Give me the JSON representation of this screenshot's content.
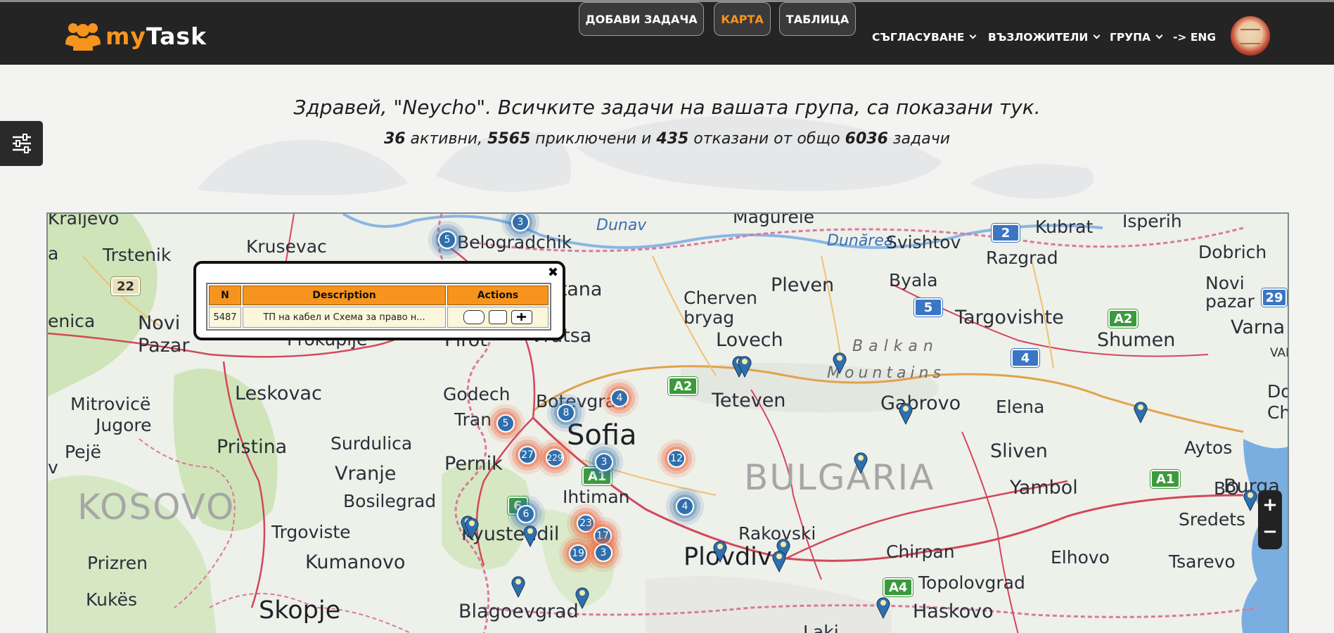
{
  "app": {
    "logo_my": "my",
    "logo_task": "Task"
  },
  "nav": {
    "add_task": "ДОБАВИ ЗАДАЧА",
    "map": "КАРТА",
    "table": "ТАБЛИЦА",
    "approval": "СЪГЛАСУВАНЕ",
    "assigners": "ВЪЗЛОЖИТЕЛИ",
    "group": "ГРУПА",
    "lang": "-> ENG",
    "active_tab": "map"
  },
  "greeting": {
    "title": "Здравей, \"Neycho\". Всичките задачи на вашата група, са показани тук.",
    "active_count": "36",
    "active_label": " активни, ",
    "finished_count": "5565",
    "finished_label": " приключени и ",
    "rejected_count": "435",
    "rejected_label": " отказани от общо ",
    "total_count": "6036",
    "total_label": " задачи"
  },
  "popup": {
    "columns": [
      "N",
      "Description",
      "Actions"
    ],
    "row": {
      "n": "5487",
      "description": "ТП на кабел и Схема за право н..."
    },
    "actions": [
      "details-icon",
      "edit-doc-icon",
      "add-icon"
    ]
  },
  "map": {
    "places": {
      "kraljevo": "Kraljevo",
      "trstenik": "Trstenik",
      "krusevac": "Krusevac",
      "belogradchik": "Belogradchik",
      "dunav": "Dunav",
      "magurele": "Magurele",
      "dunarea": "Dunărea",
      "svishtov": "Svishtov",
      "kubrat": "Kubrat",
      "isperih": "Isperih",
      "dobrich": "Dobrich",
      "razgrad": "Razgrad",
      "novi_pazar_bg": "Novi\npazar",
      "enica": "enica",
      "a_left": "a",
      "novi_pazar": "Novi\nPazar",
      "prokuplje": "Prokuplje",
      "pirot": "Pirot",
      "vratsa": "Vratsa",
      "montana": "ontana",
      "cherven_bryag": "Cherven\nbryag",
      "pleven": "Pleven",
      "byala": "Byala",
      "targovishte": "Targovishte",
      "shumen": "Shumen",
      "varna": "Varna",
      "var": "VAR",
      "lovech": "Lovech",
      "balkan": "Balkan",
      "mountains": "Mountains",
      "mitrovice": "Mitrovicë",
      "jugore": "Jugore",
      "leskovac": "Leskovac",
      "godech": "Godech",
      "botevgrad": "Botevgrad",
      "teteven": "Teteven",
      "gabrovo": "Gabrovo",
      "elena": "Elena",
      "do": "Do",
      "chi": "Chi",
      "peje": "Pejë",
      "pristina": "Pristina",
      "surdulica": "Surdulica",
      "tran": "Tran",
      "sofia": "Sofia",
      "sliven": "Sliven",
      "aytos": "Aytos",
      "v_left": "v",
      "vranje": "Vranje",
      "pernik": "Pernik",
      "ihtiman": "Ihtiman",
      "bulgaria": "BULGARIA",
      "yambol": "Yambol",
      "bo": "BO",
      "burgas": "Burga",
      "kosovo": "KOSOVO",
      "bosilegrad": "Bosilegrad",
      "sredets": "Sredets",
      "trgoviste": "Trgoviste",
      "kyustendil": "Kyustendil",
      "rakovski": "Rakovski",
      "chirpan": "Chirpan",
      "elhovo": "Elhovo",
      "prizren": "Prizren",
      "kumanovo": "Kumanovo",
      "plovdiv": "Plovdiv",
      "topolovgrad": "Topolovgrad",
      "tsarevo": "Tsarevo",
      "kukes": "Kukës",
      "skopje": "Skopje",
      "blagoevgrad": "Blagoevgrad",
      "haskovo": "Haskovo",
      "laki": "Laki"
    },
    "shields": {
      "r22": "22",
      "r2": "2",
      "r5": "5",
      "r4": "4",
      "r29": "29",
      "a2e": "A2",
      "a2": "A2",
      "a1": "A1",
      "a1e": "A1",
      "a4": "A4",
      "r6": "6"
    },
    "clusters": [
      {
        "label": "3",
        "color": "blue"
      },
      {
        "label": "5",
        "color": "blue"
      },
      {
        "label": "4",
        "color": "orange"
      },
      {
        "label": "8",
        "color": "blue"
      },
      {
        "label": "5",
        "color": "orange"
      },
      {
        "label": "27",
        "color": "orange"
      },
      {
        "label": "229",
        "color": "orange"
      },
      {
        "label": "3",
        "color": "blue"
      },
      {
        "label": "12",
        "color": "orange"
      },
      {
        "label": "4",
        "color": "blue"
      },
      {
        "label": "6",
        "color": "blue"
      },
      {
        "label": "23",
        "color": "orange"
      },
      {
        "label": "17",
        "color": "orange"
      },
      {
        "label": "19",
        "color": "orange"
      },
      {
        "label": "3",
        "color": "orange"
      }
    ],
    "zoom_in": "+",
    "zoom_out": "−"
  }
}
